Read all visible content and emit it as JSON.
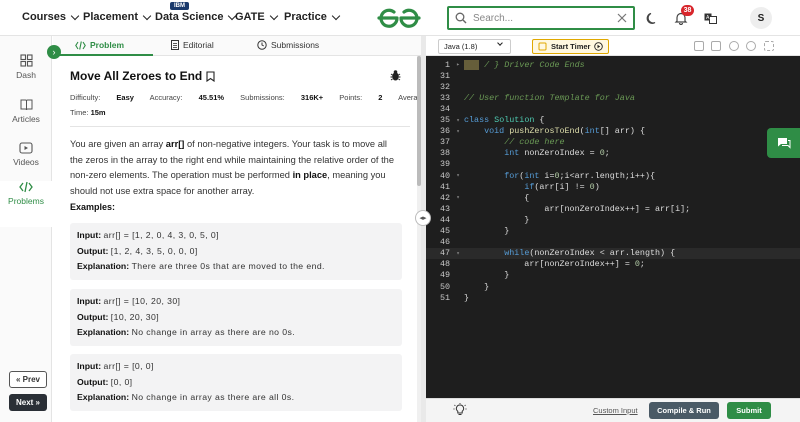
{
  "nav": {
    "courses": "Courses",
    "placement": "Placement",
    "data_science": "Data Science",
    "ibm_badge": "IBM",
    "gate": "GATE",
    "practice": "Practice",
    "logo_text": "GfG",
    "search_placeholder": "Search...",
    "notif_count": "38",
    "avatar_letter": "S"
  },
  "sidebar": {
    "items": [
      {
        "label": "Dash"
      },
      {
        "label": "Articles"
      },
      {
        "label": "Videos"
      },
      {
        "label": "Problems"
      }
    ],
    "prev": "« Prev",
    "next": "Next »"
  },
  "tabs": {
    "problem": "Problem",
    "editorial": "Editorial",
    "submissions": "Submissions"
  },
  "problem": {
    "title": "Move All Zeroes to End",
    "difficulty_label": "Difficulty:",
    "difficulty": "Easy",
    "accuracy_label": "Accuracy:",
    "accuracy": "45.51%",
    "submissions_label": "Submissions:",
    "submissions": "316K+",
    "points_label": "Points:",
    "points": "2",
    "average": "Average",
    "time_label": "Time:",
    "time": "15m",
    "desc_1": "You are given an array ",
    "desc_arr": "arr[]",
    "desc_2": " of non-negative integers. Your task is to move all the zeros in the array to the right end while maintaining the relative order of the non-zero elements. The operation must be performed ",
    "desc_inplace": "in place",
    "desc_3": ", meaning you should not use extra space for another array.",
    "examples_heading": "Examples:",
    "examples": [
      {
        "input_label": "Input:",
        "input": "arr[] = [1, 2, 0, 4, 3, 0, 5, 0]",
        "output_label": "Output:",
        "output": "[1, 2, 4, 3, 5, 0, 0, 0]",
        "expl_label": "Explanation:",
        "expl": "There are three 0s that are moved to the end."
      },
      {
        "input_label": "Input:",
        "input": "arr[] = [10, 20, 30]",
        "output_label": "Output:",
        "output": "[10, 20, 30]",
        "expl_label": "Explanation:",
        "expl": "No change in array as there are no 0s."
      },
      {
        "input_label": "Input:",
        "input": "arr[] = [0, 0]",
        "output_label": "Output:",
        "output": "[0, 0]",
        "expl_label": "Explanation:",
        "expl": "No change in array as there are all 0s."
      }
    ]
  },
  "editor": {
    "language": "Java (1.8)",
    "start_timer": "Start Timer",
    "custom_input": "Custom Input",
    "compile_run": "Compile & Run",
    "submit": "Submit"
  },
  "code_lines": [
    {
      "n": "1",
      "fold": "▸",
      "text": "/ } Driver Code Ends"
    },
    {
      "n": "31",
      "fold": "",
      "text": ""
    },
    {
      "n": "32",
      "fold": "",
      "text": ""
    },
    {
      "n": "33",
      "fold": "",
      "text": "// User function Template for Java"
    },
    {
      "n": "34",
      "fold": "",
      "text": ""
    },
    {
      "n": "35",
      "fold": "▾",
      "text": "class Solution {"
    },
    {
      "n": "36",
      "fold": "▾",
      "text": "    void pushZerosToEnd(int[] arr) {"
    },
    {
      "n": "37",
      "fold": "",
      "text": "        // code here"
    },
    {
      "n": "38",
      "fold": "",
      "text": "        int nonZeroIndex = 0;"
    },
    {
      "n": "39",
      "fold": "",
      "text": ""
    },
    {
      "n": "40",
      "fold": "▾",
      "text": "        for(int i=0;i<arr.length;i++){"
    },
    {
      "n": "41",
      "fold": "",
      "text": "            if(arr[i] != 0)"
    },
    {
      "n": "42",
      "fold": "▾",
      "text": "            {"
    },
    {
      "n": "43",
      "fold": "",
      "text": "                arr[nonZeroIndex++] = arr[i];"
    },
    {
      "n": "44",
      "fold": "",
      "text": "            }"
    },
    {
      "n": "45",
      "fold": "",
      "text": "        }"
    },
    {
      "n": "46",
      "fold": "",
      "text": ""
    },
    {
      "n": "47",
      "fold": "▾",
      "text": "        while(nonZeroIndex < arr.length) {"
    },
    {
      "n": "48",
      "fold": "",
      "text": "            arr[nonZeroIndex++] = 0;"
    },
    {
      "n": "49",
      "fold": "",
      "text": "        }"
    },
    {
      "n": "50",
      "fold": "",
      "text": "    }"
    },
    {
      "n": "51",
      "fold": "",
      "text": "}"
    }
  ],
  "colors": {
    "brand_green": "#2f8d46",
    "editor_bg": "#1e1e1e",
    "notif_red": "#d8262c"
  }
}
